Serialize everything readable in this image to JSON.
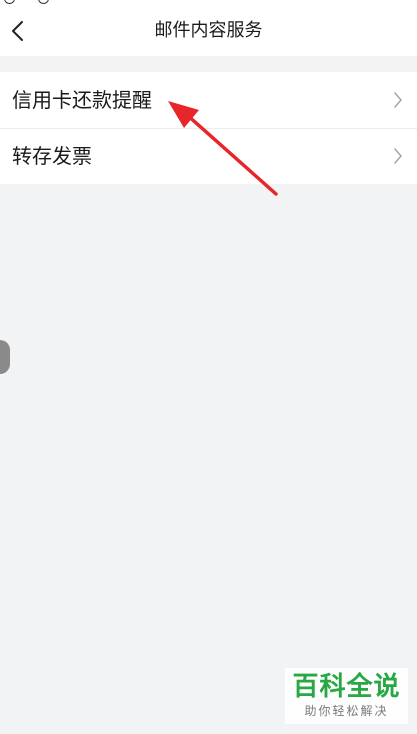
{
  "header": {
    "title": "邮件内容服务",
    "back_icon": "chevron-left-icon"
  },
  "menu": {
    "items": [
      {
        "label": "信用卡还款提醒",
        "icon": "chevron-right-icon"
      },
      {
        "label": "转存发票",
        "icon": "chevron-right-icon"
      }
    ]
  },
  "annotation": {
    "arrow_color": "#e8262a"
  },
  "watermark": {
    "title": "百科全说",
    "subtitle": "助你轻松解决",
    "color": "#27a844"
  }
}
